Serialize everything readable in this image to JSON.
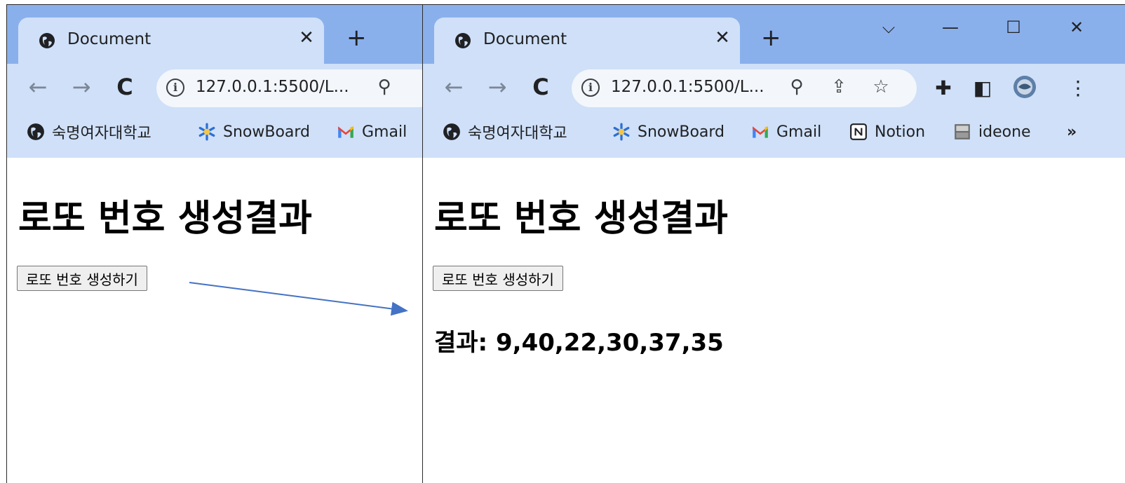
{
  "left_window": {
    "tab": {
      "title": "Document",
      "icon": "globe-icon"
    },
    "omnibox": {
      "url": "127.0.0.1:5500/L..."
    },
    "bookmarks": [
      {
        "label": "숙명여자대학교",
        "icon": "globe-icon"
      },
      {
        "label": "SnowBoard",
        "icon": "snowflake-icon"
      },
      {
        "label": "Gmail",
        "icon": "gmail-icon"
      }
    ],
    "page": {
      "title": "로또 번호 생성결과",
      "button_label": "로또 번호 생성하기"
    }
  },
  "right_window": {
    "tab": {
      "title": "Document",
      "icon": "globe-icon"
    },
    "omnibox": {
      "url": "127.0.0.1:5500/L..."
    },
    "bookmarks": [
      {
        "label": "숙명여자대학교",
        "icon": "globe-icon"
      },
      {
        "label": "SnowBoard",
        "icon": "snowflake-icon"
      },
      {
        "label": "Gmail",
        "icon": "gmail-icon"
      },
      {
        "label": "Notion",
        "icon": "notion-icon"
      },
      {
        "label": "ideone",
        "icon": "ideone-icon"
      }
    ],
    "page": {
      "title": "로또 번호 생성결과",
      "button_label": "로또 번호 생성하기",
      "result": "결과: 9,40,22,30,37,35"
    }
  },
  "colors": {
    "tabstrip": "#8ab0ec",
    "active_tab": "#cfe0f8",
    "annotation_arrow": "#4472c4"
  }
}
